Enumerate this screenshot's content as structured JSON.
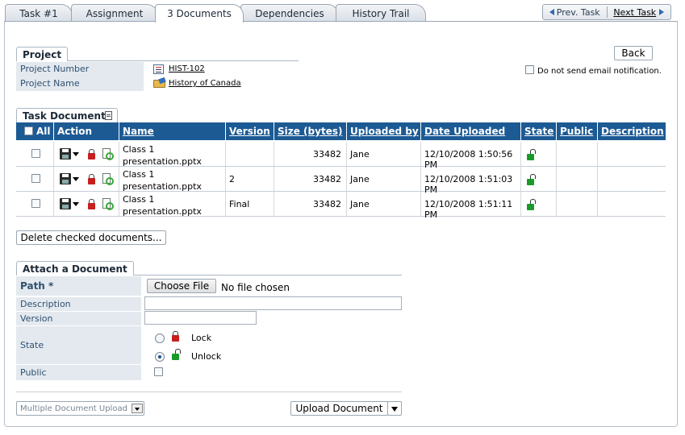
{
  "tabs": [
    {
      "label": "Task #1"
    },
    {
      "label": "Assignment"
    },
    {
      "label": "3 Documents"
    },
    {
      "label": "Dependencies"
    },
    {
      "label": "History Trail"
    }
  ],
  "nav": {
    "prev": "Prev. Task",
    "next": "Next Task"
  },
  "project": {
    "section_label": "Project",
    "number_label": "Project Number",
    "number_value": "HIST-102",
    "name_label": "Project Name",
    "name_value": "History of Canada"
  },
  "back_label": "Back",
  "email_notify_label": "Do not send email notification.",
  "documents": {
    "section_label": "Task Documents",
    "columns": {
      "all": "All",
      "action": "Action",
      "name": "Name",
      "version": "Version",
      "size": "Size (bytes)",
      "uploaded_by": "Uploaded by",
      "date_uploaded": "Date Uploaded",
      "state": "State",
      "public": "Public",
      "description": "Description"
    },
    "rows": [
      {
        "name_line1": "Class 1",
        "name_line2": "presentation.pptx",
        "version": "",
        "size": "33482",
        "uploaded_by": "Jane",
        "date": "12/10/2008 1:50:56 PM",
        "state": "unlocked",
        "public": "",
        "description": ""
      },
      {
        "name_line1": "Class 1",
        "name_line2": "presentation.pptx",
        "version": "2",
        "size": "33482",
        "uploaded_by": "Jane",
        "date": "12/10/2008 1:51:03 PM",
        "state": "unlocked",
        "public": "",
        "description": ""
      },
      {
        "name_line1": "Class 1",
        "name_line2": "presentation.pptx",
        "version": "Final",
        "size": "33482",
        "uploaded_by": "Jane",
        "date": "12/10/2008 1:51:11 PM",
        "state": "unlocked",
        "public": "",
        "description": ""
      }
    ],
    "delete_label": "Delete checked documents..."
  },
  "attach": {
    "section_label": "Attach a Document",
    "path_label": "Path *",
    "choose_file_label": "Choose File",
    "no_file_label": "No file chosen",
    "description_label": "Description",
    "version_label": "Version",
    "state_label": "State",
    "lock_label": "Lock",
    "unlock_label": "Unlock",
    "state_selected": "Unlock",
    "public_label": "Public",
    "multi_upload_label": "Multiple Document Upload",
    "upload_label": "Upload Document"
  },
  "colors": {
    "header_blue": "#1c5a94",
    "label_bg": "#e3e9ef",
    "label_text": "#30506f"
  }
}
